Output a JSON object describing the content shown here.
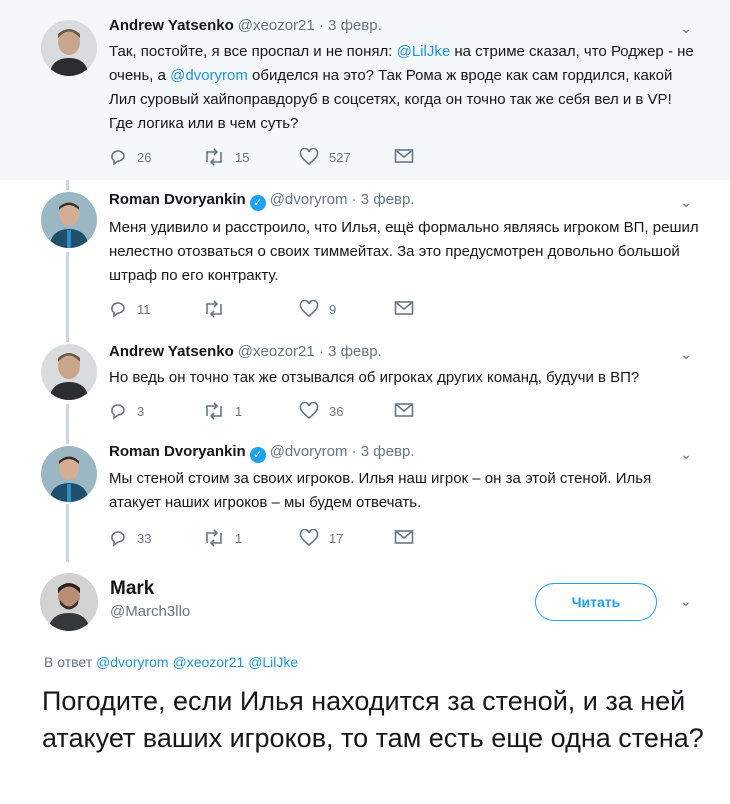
{
  "tweets": [
    {
      "name": "Andrew Yatsenko",
      "handle": "@xeozor21",
      "date": "3 февр.",
      "verified": false,
      "text_parts": [
        "Так, постойте, я все проспал и не понял: ",
        "@LilJke",
        " на стриме сказал, что Роджер - не очень, а ",
        "@dvoryrom",
        " обиделся на это? Так Рома ж вроде как сам гордился, какой Лил суровый хайпоправдоруб в соцсетях, когда он точно так же себя вел и в VP! Где логика или в чем суть?"
      ],
      "replies": "26",
      "retweets": "15",
      "likes": "527"
    },
    {
      "name": "Roman Dvoryankin",
      "handle": "@dvoryrom",
      "date": "3 февр.",
      "verified": true,
      "text": "Меня удивило и расстроило, что Илья, ещё формально являясь игроком ВП, решил нелестно отозваться о своих тиммейтах. За это предусмотрен довольно большой штраф по его контракту.",
      "replies": "11",
      "retweets": "",
      "likes": "9"
    },
    {
      "name": "Andrew Yatsenko",
      "handle": "@xeozor21",
      "date": "3 февр.",
      "verified": false,
      "text": "Но ведь он точно так же отзывался об игроках других команд, будучи в ВП?",
      "replies": "3",
      "retweets": "1",
      "likes": "36"
    },
    {
      "name": "Roman Dvoryankin",
      "handle": "@dvoryrom",
      "date": "3 февр.",
      "verified": true,
      "text": "Мы стеной стоим за своих игроков. Илья наш игрок – он за этой стеной. Илья атакует наших игроков – мы будем отвечать.",
      "replies": "33",
      "retweets": "1",
      "likes": "17"
    }
  ],
  "main": {
    "name": "Mark",
    "handle": "@March3llo",
    "follow_label": "Читать",
    "reply_prefix": "В ответ",
    "reply_mentions": [
      "@dvoryrom",
      "@xeozor21",
      "@LilJke"
    ],
    "text": "Погодите, если Илья находится за стеной, и за ней атакует ваших игроков, то там есть еще одна стена?"
  },
  "icons": {
    "reply": "reply-icon",
    "retweet": "retweet-icon",
    "like": "heart-icon",
    "dm": "envelope-icon",
    "caret": "chevron-down-icon",
    "verified": "verified-badge-icon"
  },
  "colors": {
    "accent": "#1da1f2",
    "mention": "#1b95e0",
    "muted": "#657786",
    "thread_line": "#ccd6dd",
    "highlight_bg": "#f5f8fa"
  }
}
